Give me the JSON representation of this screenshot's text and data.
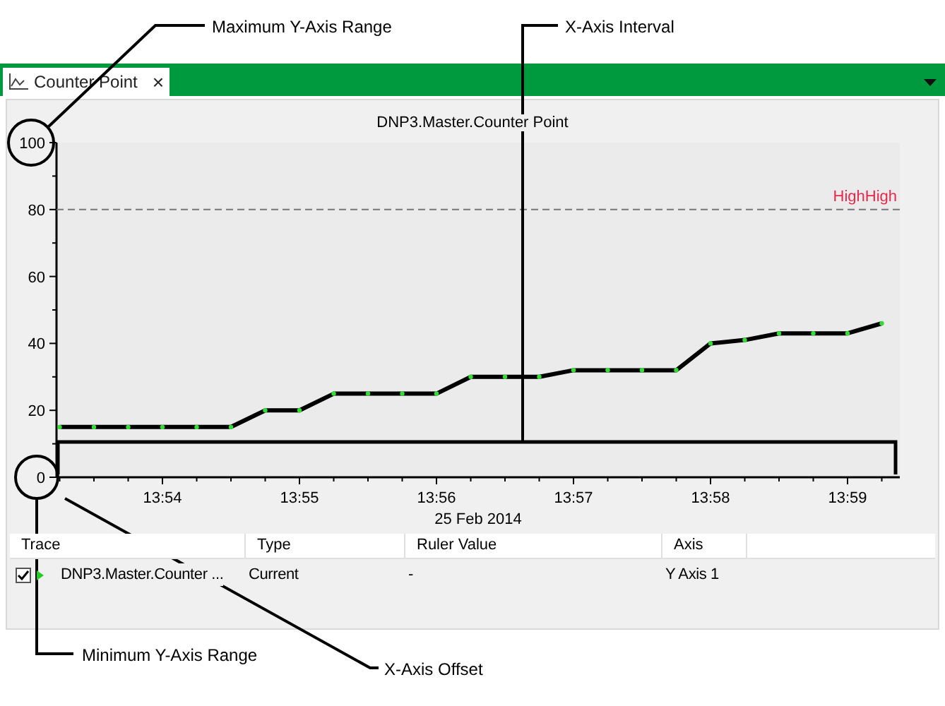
{
  "callouts": [
    {
      "kind": "max_y",
      "label": "Maximum Y-Axis Range"
    },
    {
      "kind": "interval",
      "label": "X-Axis Interval"
    },
    {
      "kind": "min_y",
      "label": "Minimum Y-Axis Range"
    },
    {
      "kind": "offset",
      "label": "X-Axis Offset"
    }
  ],
  "tab": {
    "label": "Counter Point",
    "close": "×",
    "selected": true
  },
  "chart": {
    "title": "DNP3.Master.Counter Point",
    "chart_data": {
      "type": "line",
      "xlabel": "25 Feb 2014",
      "ylim": [
        0,
        100
      ],
      "yticks": [
        0,
        20,
        40,
        60,
        80,
        100
      ],
      "categories": [
        null,
        null,
        null,
        "13:54",
        null,
        null,
        null,
        "13:55",
        null,
        null,
        null,
        "13:56",
        null,
        null,
        null,
        "13:57",
        null,
        null,
        null,
        "13:58",
        null,
        null,
        null,
        "13:59",
        null
      ],
      "series": [
        {
          "color": "#000000",
          "marker": "circle",
          "values": [
            15,
            15,
            15,
            15,
            15,
            15,
            20,
            20,
            25,
            25,
            25,
            25,
            30,
            30,
            30,
            32,
            32,
            32,
            32,
            40,
            41,
            43,
            43,
            43,
            46
          ]
        }
      ],
      "ref_lines": [
        {
          "axis": "y",
          "value": 80,
          "label": "HighHigh"
        }
      ]
    }
  },
  "table": {
    "columns": [
      "Trace",
      "Type",
      "Ruler Value",
      "Axis"
    ],
    "rows": [
      {
        "checked": true,
        "cells": [
          "DNP3.Master.Counter ...",
          "Current",
          "-",
          "Y Axis 1"
        ]
      }
    ]
  }
}
